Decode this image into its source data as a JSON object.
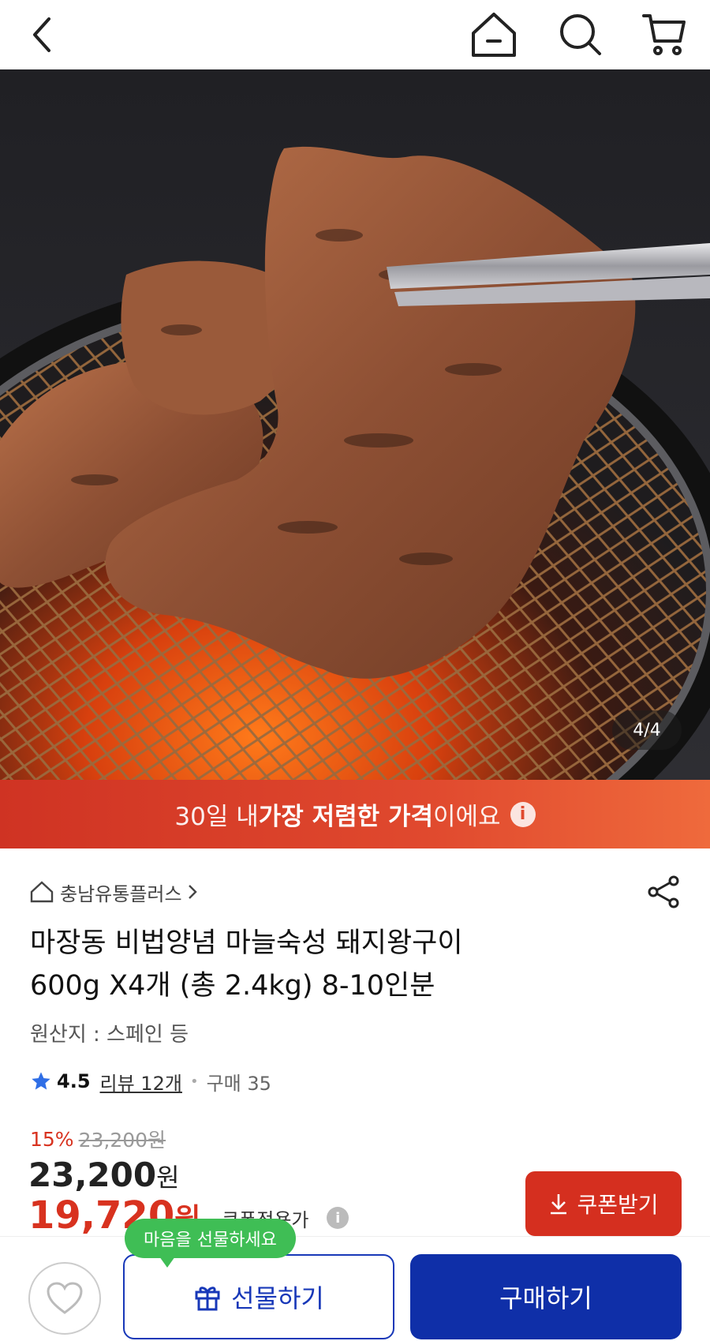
{
  "header": {
    "back_icon": "chevron-left-icon",
    "home_icon": "home-icon",
    "search_icon": "search-icon",
    "cart_icon": "cart-icon"
  },
  "hero": {
    "image_counter": "4/4"
  },
  "promo": {
    "pre": "30일 내 ",
    "bold": "가장 저렴한 가격",
    "post": "이에요",
    "info_icon": "i"
  },
  "product": {
    "store_name": "충남유통플러스",
    "title_line1": "마장동 비법양념 마늘숙성 돼지왕구이",
    "title_line2": "600g X4개 (총 2.4kg) 8-10인분",
    "origin": "원산지 : 스페인 등",
    "rating": "4.5",
    "reviews": "리뷰 12개",
    "purchases": "구매 35",
    "discount_rate": "15%",
    "original_price": "23,200원",
    "price_number": "23,200",
    "price_unit": "원",
    "coupon_price_number": "19,720",
    "coupon_price_unit": "원",
    "coupon_price_label": "쿠폰적용가"
  },
  "coupon_button": {
    "label": "쿠폰받기"
  },
  "bottom_bar": {
    "tooltip": "마음을 선물하세요",
    "gift_label": "선물하기",
    "buy_label": "구매하기"
  },
  "colors": {
    "accent_red": "#d52f1f",
    "primary_blue": "#0f2fa8",
    "tooltip_green": "#3fbe55"
  }
}
